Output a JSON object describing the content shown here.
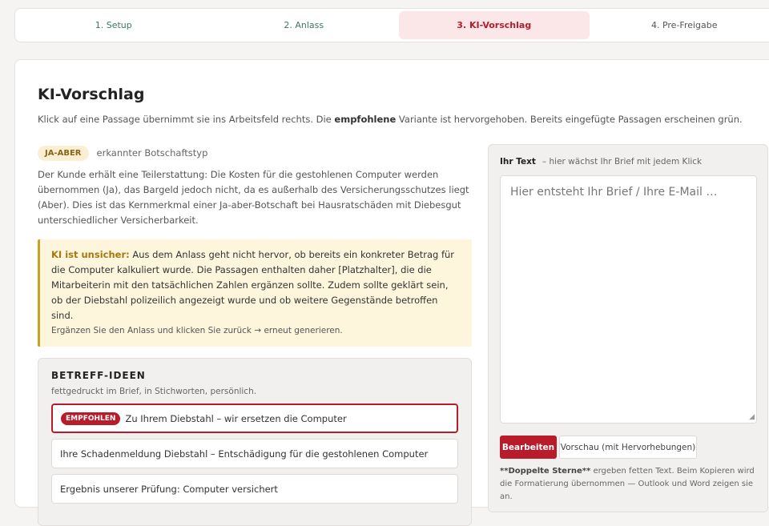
{
  "steps": [
    {
      "label": "1.  Setup",
      "state": "done"
    },
    {
      "label": "2.  Anlass",
      "state": "done"
    },
    {
      "label": "3.  KI-Vorschlag",
      "state": "active"
    },
    {
      "label": "4.  Pre-Freigabe",
      "state": "todo"
    }
  ],
  "title": "KI-Vorschlag",
  "intro": {
    "pre": "Klick auf eine Passage übernimmt sie ins Arbeitsfeld rechts. Die ",
    "bold": "empfohlene",
    "post": " Variante ist hervorgehoben. Bereits eingefügte Passagen erscheinen grün."
  },
  "message_type": {
    "badge": "JA-ABER",
    "label": "erkannter Botschaftstyp",
    "description": "Der Kunde erhält eine Teilerstattung: Die Kosten für die gestohlenen Computer werden übernommen (Ja), das Bargeld jedoch nicht, da es außerhalb des Versicherungsschutzes liegt (Aber). Dies ist das Kernmerkmal einer Ja-aber-Botschaft bei Hausratschäden mit Diebesgut unterschiedlicher Versicherbarkeit."
  },
  "warning": {
    "lead": "KI ist unsicher:",
    "text": " Aus dem Anlass geht nicht hervor, ob bereits ein konkreter Betrag für die Computer kalkuliert wurde. Die Passagen enthalten daher [Platzhalter], die die Mitarbeiterin mit den tatsächlichen Zahlen ergänzen sollte. Zudem sollte geklärt sein, ob der Diebstahl polizeilich angezeigt wurde und ob weitere Gegenstände betroffen sind.",
    "note": "Ergänzen Sie den Anlass und klicken Sie zurück → erneut generieren."
  },
  "subjects": {
    "title": "BETREFF-IDEEN",
    "hint": "fettgedruckt im Brief, in Stichworten, persönlich.",
    "recommended_badge": "EMPFOHLEN",
    "options": [
      "Zu Ihrem Diebstahl – wir ersetzen die Computer",
      "Ihre Schadenmeldung Diebstahl – Entschädigung für die gestohlenen Computer",
      "Ergebnis unserer Prüfung: Computer versichert"
    ]
  },
  "editor": {
    "head_bold": "Ihr Text",
    "head_rest": "– hier wächst Ihr Brief mit jedem Klick",
    "placeholder": "Hier entsteht Ihr Brief / Ihre E-Mail …",
    "edit_button": "Bearbeiten",
    "preview_button": "Vorschau (mit Hervorhebungen)",
    "foot_bold": "**Doppelte Sterne**",
    "foot_rest": " ergeben fetten Text. Beim Kopieren wird die Formatierung übernommen — Outlook und Word zeigen sie an."
  },
  "colors": {
    "accent": "#b81b2a",
    "warning": "#c9a124",
    "done": "#3c7a5e"
  }
}
